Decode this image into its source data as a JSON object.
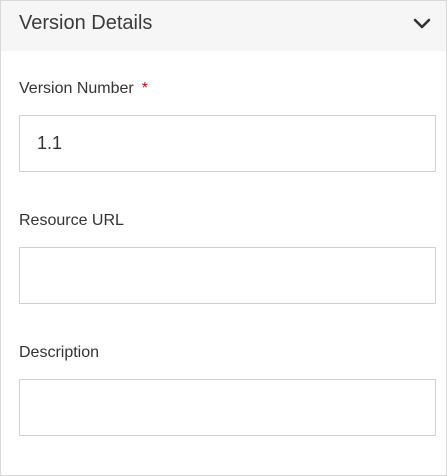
{
  "panel": {
    "title": "Version Details",
    "toggle_icon": "chevron-down-icon"
  },
  "form": {
    "version_number": {
      "label": "Version Number",
      "required_mark": "*",
      "value": "1.1"
    },
    "resource_url": {
      "label": "Resource URL",
      "value": ""
    },
    "description": {
      "label": "Description",
      "value": ""
    }
  },
  "colors": {
    "header_bg": "#f6f6f6",
    "required": "#d0021b",
    "border": "#cfcfcf"
  }
}
